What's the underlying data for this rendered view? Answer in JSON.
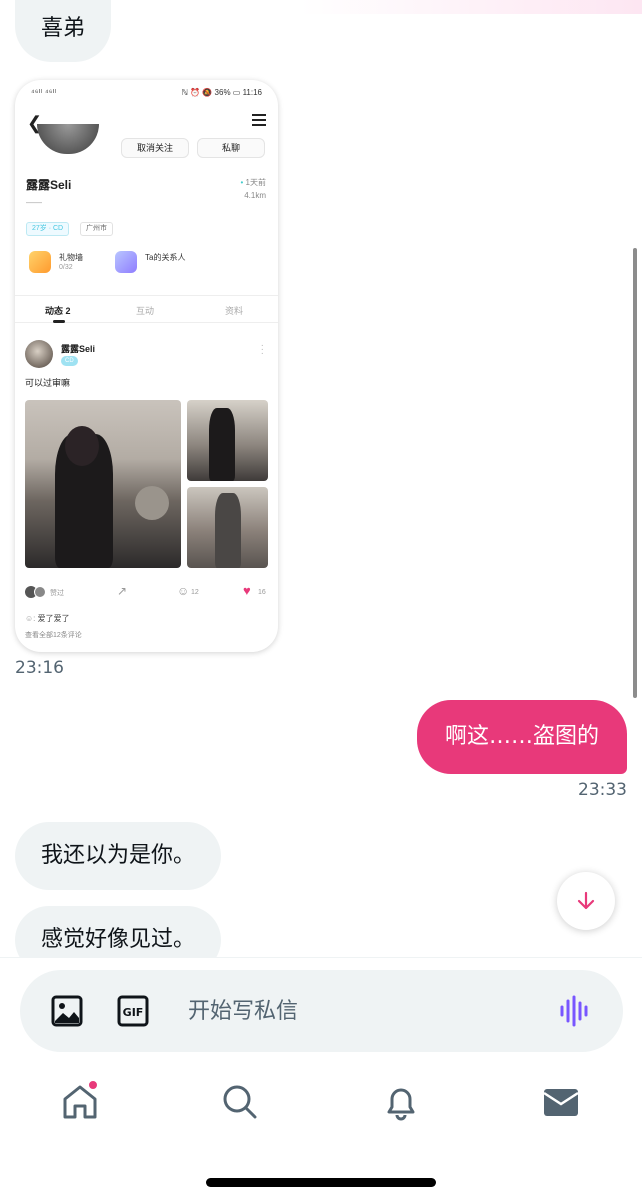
{
  "colors": {
    "accent": "#e8397a",
    "bubble_in": "#eff3f4",
    "text_secondary": "#536471",
    "voice": "#7856ff"
  },
  "messages": {
    "m1": "喜弟",
    "m1_time": "23:16",
    "m2": "啊这……盗图的",
    "m2_time": "23:33",
    "m3": "我还以为是你。",
    "m4": "感觉好像见过。"
  },
  "embedded_screenshot": {
    "status_left": "⁴⁶ᴵˡ ⁴⁶ᴵˡ",
    "status_right": "ℕ ⏰ 🔕 36% ▭ 11:16",
    "unfollow_label": "取消关注",
    "message_label": "私聊",
    "username": "露露Seli",
    "bio_placeholder": "——",
    "active_time": "1天前",
    "distance": "4.1km",
    "tag_age": "27岁 · CD",
    "tag_city": "广州市",
    "gift_wall_label": "礼物墙",
    "gift_wall_count": "0/32",
    "relationship_label": "Ta的关系人",
    "tabs": [
      "动态 2",
      "互动",
      "资料"
    ],
    "post_author": "露露Seli",
    "post_badge": "CD",
    "post_text": "可以过审嘛",
    "liked_by_label": "赞过",
    "comment_count": "12",
    "like_count": "16",
    "comment_preview": "爱了爱了",
    "view_all_comments": "查看全部12条评论"
  },
  "composer": {
    "placeholder": "开始写私信"
  },
  "nav": {
    "items": [
      "home-icon",
      "search-icon",
      "bell-icon",
      "mail-icon"
    ]
  }
}
